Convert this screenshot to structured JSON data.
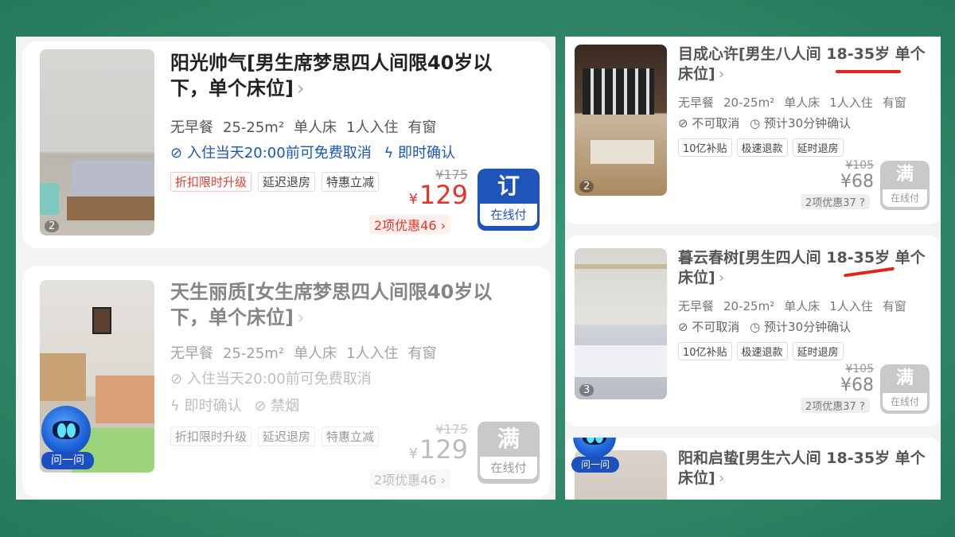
{
  "left": {
    "listings": [
      {
        "title": "阳光帅气[男生席梦思四人间限40岁以下，单个床位]",
        "chevron": "›",
        "meta": [
          "无早餐",
          "25-25m²",
          "单人床",
          "1人入住",
          "有窗"
        ],
        "policy1": "入住当天20:00前可免费取消",
        "policy2": "即时确认",
        "tags": [
          "折扣限时升级",
          "延迟退房",
          "特惠立减"
        ],
        "original_price": "¥175",
        "currency": "¥",
        "price": "129",
        "discount": "2项优惠46 ›",
        "btn_top": "订",
        "btn_bottom": "在线付",
        "photo_count": "2"
      },
      {
        "title": "天生丽质[女生席梦思四人间限40岁以下，单个床位]",
        "chevron": "›",
        "meta": [
          "无早餐",
          "25-25m²",
          "单人床",
          "1人入住",
          "有窗"
        ],
        "policy1": "入住当天20:00前可免费取消",
        "policy2": "即时确认",
        "policy3": "禁烟",
        "tags": [
          "折扣限时升级",
          "延迟退房",
          "特惠立减"
        ],
        "original_price": "¥175",
        "currency": "¥",
        "price": "129",
        "discount": "2项优惠46 ›",
        "btn_top": "满",
        "btn_bottom": "在线付",
        "assistant_label": "问一问"
      }
    ]
  },
  "right": {
    "listings": [
      {
        "title": "目成心许[男生八人间 18-35岁 单个床位]",
        "chevron": "›",
        "meta": [
          "无早餐",
          "20-25m²",
          "单人床",
          "1人入住",
          "有窗"
        ],
        "policy1": "不可取消",
        "policy2": "预计30分钟确认",
        "tags": [
          "10亿补贴",
          "极速退款",
          "延时退房"
        ],
        "original_price": "¥105",
        "price": "¥68",
        "discount": "2项优惠37",
        "btn_top": "满",
        "btn_bottom": "在线付",
        "photo_count": "2"
      },
      {
        "title": "暮云春树[男生四人间 18-35岁 单个床位]",
        "chevron": "›",
        "meta": [
          "无早餐",
          "20-25m²",
          "单人床",
          "1人入住",
          "有窗"
        ],
        "policy1": "不可取消",
        "policy2": "预计30分钟确认",
        "tags": [
          "10亿补贴",
          "极速退款",
          "延时退房"
        ],
        "original_price": "¥105",
        "price": "¥68",
        "discount": "2项优惠37",
        "btn_top": "满",
        "btn_bottom": "在线付",
        "photo_count": "3"
      },
      {
        "title": "阳和启蛰[男生六人间 18-35岁 单个床位]",
        "chevron": "›",
        "assistant_label": "问一问"
      }
    ]
  },
  "colors": {
    "background": "#2e8a68",
    "price_red": "#e6342a",
    "policy_blue": "#1a56b8",
    "book_button": "#1f55b8",
    "full_button": "#c9c9cb",
    "annotation_red": "#e2231a"
  }
}
